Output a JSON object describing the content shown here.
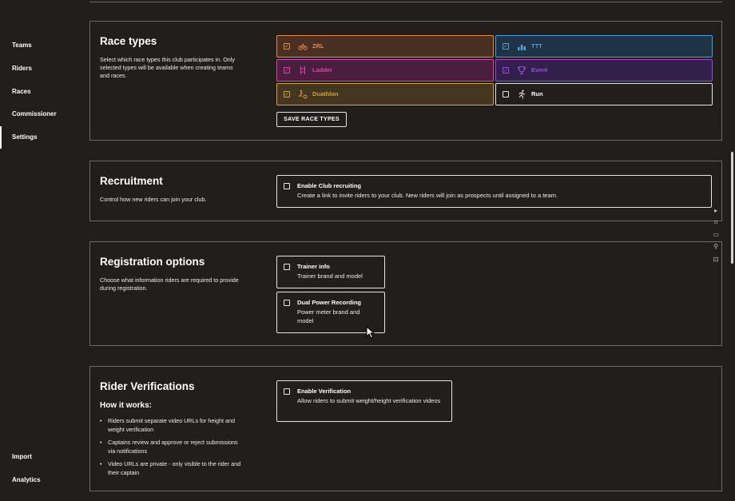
{
  "sidebar": {
    "items": [
      {
        "label": "Teams"
      },
      {
        "label": "Riders"
      },
      {
        "label": "Races"
      },
      {
        "label": "Commissioner"
      },
      {
        "label": "Settings"
      }
    ],
    "bottom": [
      {
        "label": "Import"
      },
      {
        "label": "Analytics"
      }
    ]
  },
  "race_types": {
    "title": "Race types",
    "description": "Select which race types this club participates in. Only selected types will be available when creating teams and races.",
    "save_label": "SAVE RACE TYPES",
    "types": [
      {
        "label": "ZRL",
        "checked": true,
        "color": "#e8864a",
        "bg": "#4a3022",
        "icon": "bike-icon"
      },
      {
        "label": "TTT",
        "checked": true,
        "color": "#4aa0e0",
        "bg": "#1f3346",
        "icon": "bars-icon"
      },
      {
        "label": "Ladder",
        "checked": true,
        "color": "#e040b0",
        "bg": "#4a1f3e",
        "icon": "ladder-icon"
      },
      {
        "label": "Event",
        "checked": true,
        "color": "#9a4ae0",
        "bg": "#33204a",
        "icon": "trophy-icon"
      },
      {
        "label": "Duathlon",
        "checked": true,
        "color": "#d4a038",
        "bg": "#453620",
        "icon": "duathlon-icon"
      },
      {
        "label": "Run",
        "checked": false,
        "color": "#e8e4e2",
        "bg": "#221e1c",
        "icon": "runner-icon"
      }
    ]
  },
  "recruitment": {
    "title": "Recruitment",
    "description": "Control how new riders can join your club.",
    "option_title": "Enable Club recruiting",
    "option_desc": "Create a link to invite riders to your club. New riders will join as prospects until assigned to a team."
  },
  "registration": {
    "title": "Registration options",
    "description": "Choose what information riders are required to provide during registration.",
    "options": [
      {
        "title": "Trainer info",
        "desc": "Trainer brand and model"
      },
      {
        "title": "Dual Power Recording",
        "desc": "Power meter brand and model"
      }
    ]
  },
  "verifications": {
    "title": "Rider Verifications",
    "how_title": "How it works:",
    "bullets": [
      "Riders submit separate video URLs for height and weight verification",
      "Captains review and approve or reject submissions via notifications",
      "Video URLs are private - only visible to the rider and their captain"
    ],
    "option_title": "Enable Verification",
    "option_desc": "Allow riders to submit weight/height verification videos"
  }
}
